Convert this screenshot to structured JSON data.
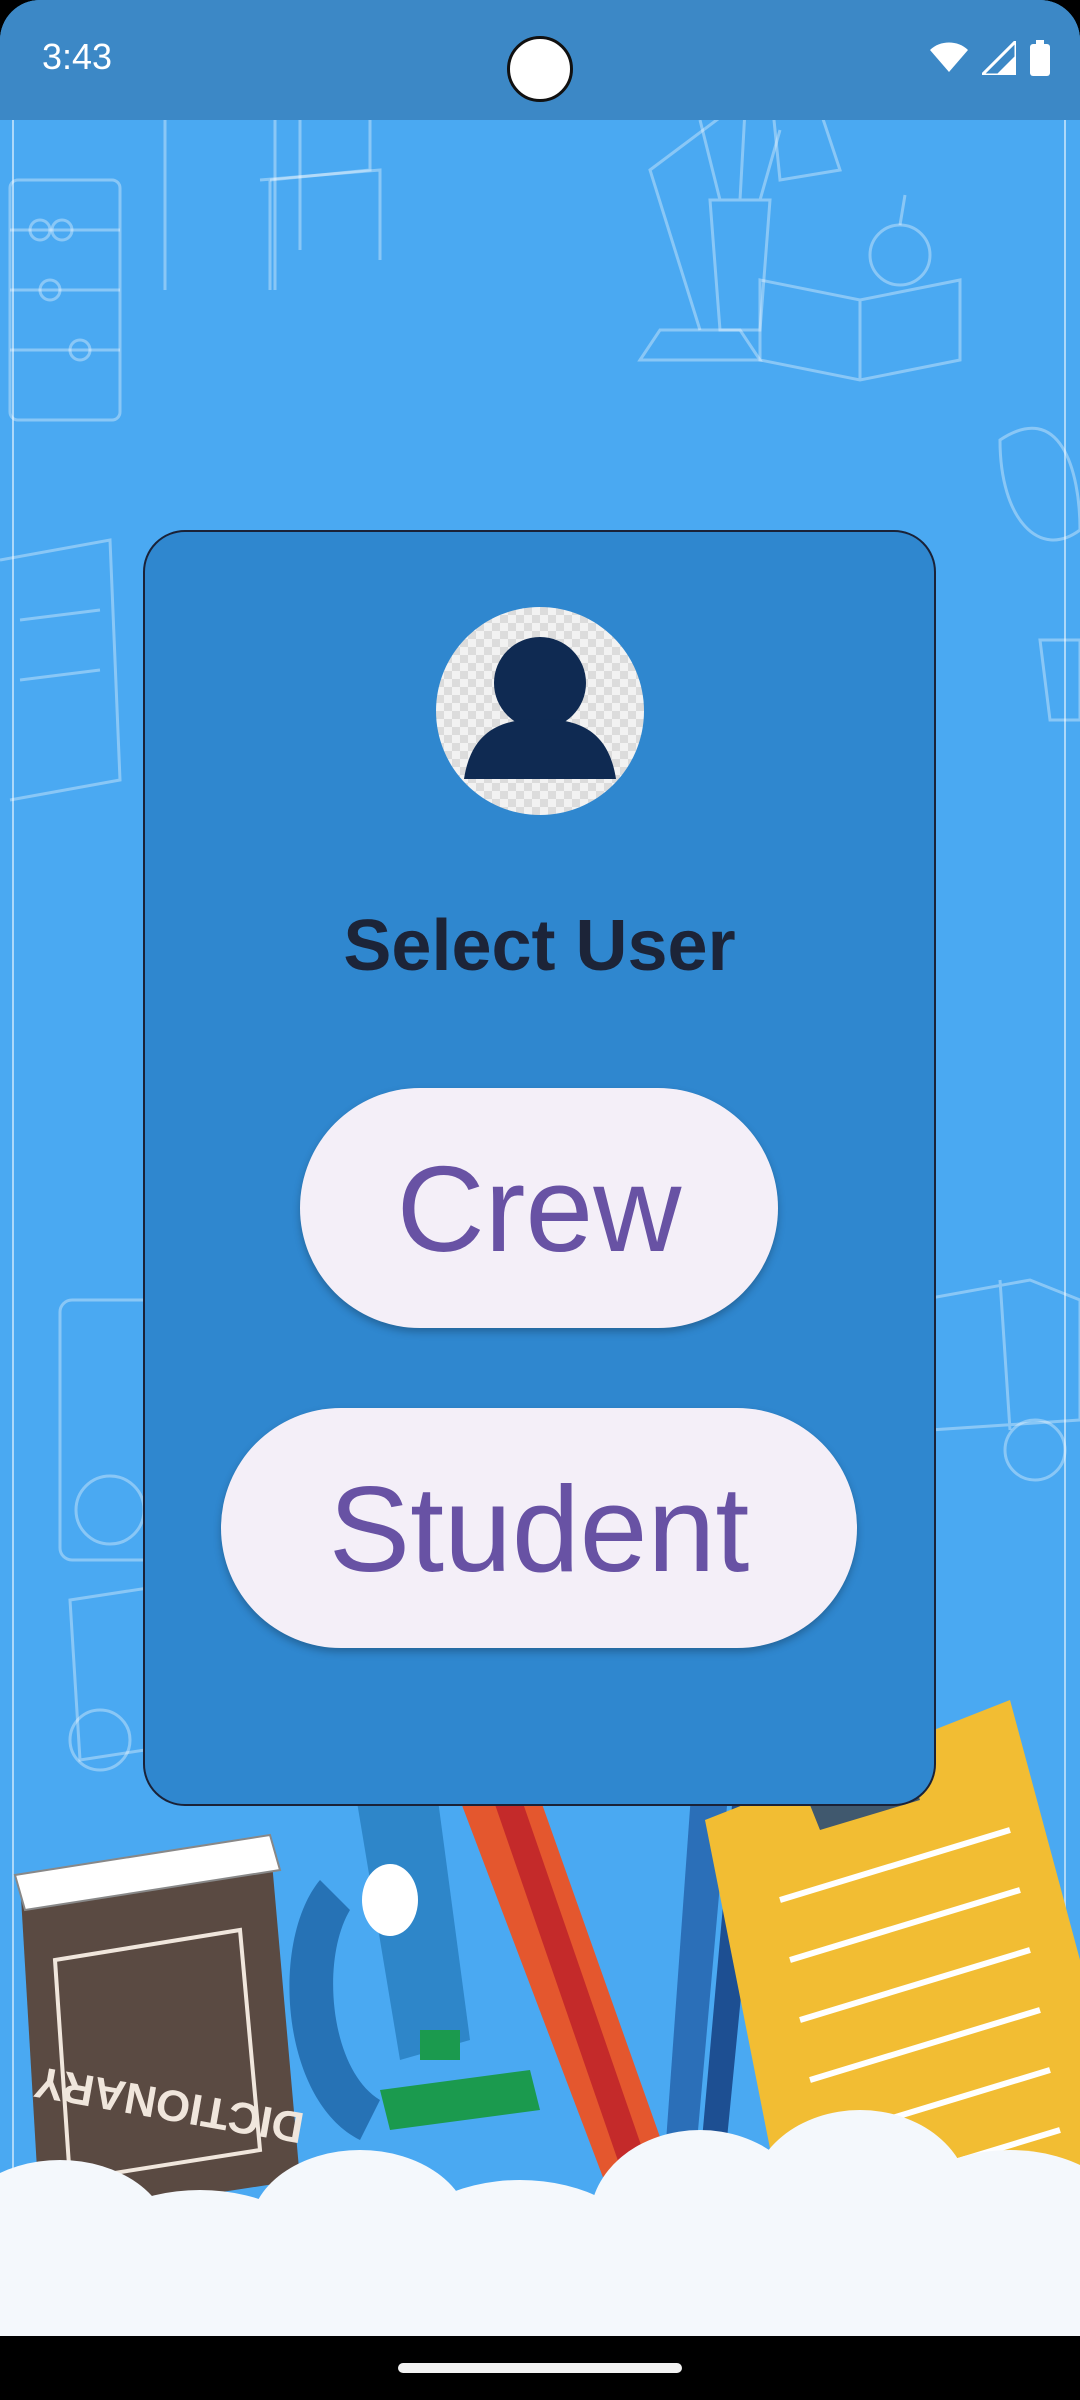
{
  "status_bar": {
    "time": "3:43"
  },
  "select": {
    "title": "Select User",
    "crew_label": "Crew",
    "student_label": "Student"
  },
  "icons": {
    "avatar": "user-avatar-icon",
    "wifi": "wifi-icon",
    "signal": "cell-signal-icon",
    "battery": "battery-icon"
  },
  "colors": {
    "background": "#4aa9f2",
    "card": "#2f87cf",
    "button_bg": "#f4eff8",
    "button_text": "#6852a4",
    "title_text": "#1c2438"
  },
  "illustration": {
    "book_spine_text": "DICTIONARY"
  }
}
